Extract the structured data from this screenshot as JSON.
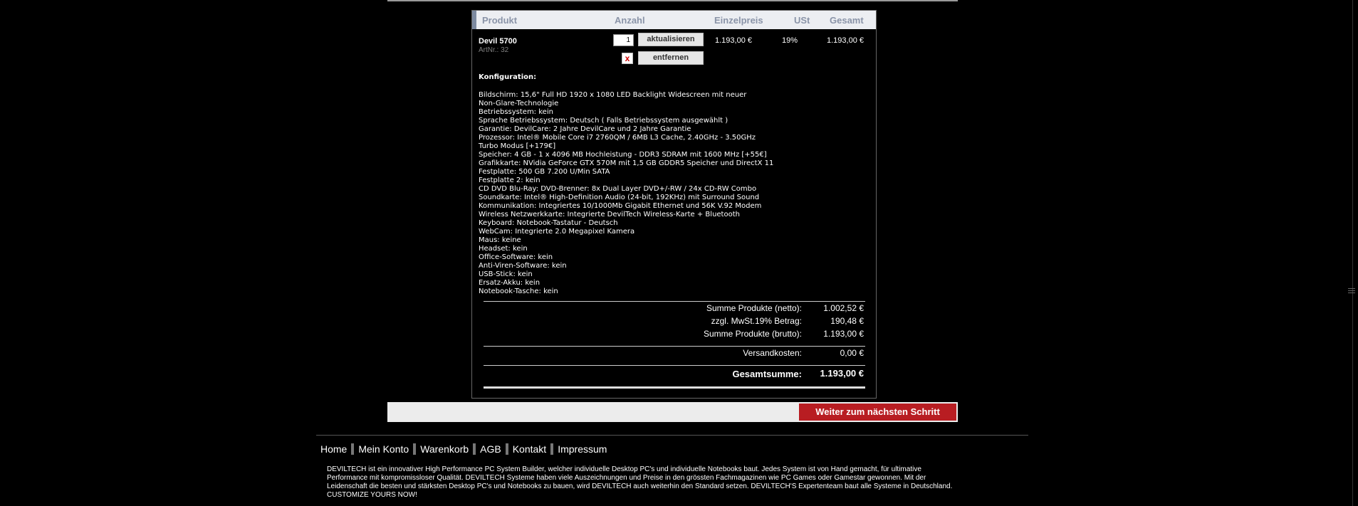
{
  "header": {
    "produkt": "Produkt",
    "anzahl": "Anzahl",
    "einzelpreis": "Einzelpreis",
    "ust": "USt",
    "gesamt": "Gesamt"
  },
  "item": {
    "name": "Devil 5700",
    "artnr": "ArtNr.: 32",
    "quantity": "1",
    "update_label": "aktualisieren",
    "remove_icon": "x",
    "remove_label": "entfernen",
    "unit_price": "1.193,00 €",
    "vat": "19%",
    "total": "1.193,00 €"
  },
  "config": {
    "title": "Konfiguration:",
    "lines": [
      "Bildschirm: 15,6\" Full HD 1920 x 1080 LED Backlight Widescreen mit neuer",
      "Non-Glare-Technologie",
      "Betriebssystem: kein",
      "Sprache Betriebssystem: Deutsch ( Falls Betriebssystem ausgewählt )",
      "Garantie: DevilCare: 2 Jahre DevilCare und 2 Jahre Garantie",
      "Prozessor: Intel® Mobile Core i7 2760QM / 6MB L3 Cache, 2.40GHz - 3.50GHz",
      "Turbo Modus [+179€]",
      "Speicher: 4 GB - 1 x 4096 MB Hochleistung - DDR3 SDRAM mit 1600 MHz [+55€]",
      "Grafikkarte: NVidia GeForce GTX 570M mit 1,5 GB GDDR5 Speicher und DirectX 11",
      "Festplatte: 500 GB 7.200 U/Min SATA",
      "Festplatte 2: kein",
      "CD DVD Blu-Ray: DVD-Brenner: 8x Dual Layer DVD+/-RW / 24x CD-RW Combo",
      "Soundkarte: Intel® High-Definition Audio (24-bit, 192KHz) mit Surround Sound",
      "Kommunikation: Integriertes 10/1000Mb Gigabit Ethernet und 56K V.92 Modem",
      "Wireless Netzwerkkarte: Integrierte DevilTech Wireless-Karte + Bluetooth",
      "Keyboard: Notebook-Tastatur - Deutsch",
      "WebCam: Integrierte 2.0 Megapixel Kamera",
      "Maus: keine",
      "Headset: kein",
      "Office-Software: kein",
      "Anti-Viren-Software: kein",
      "USB-Stick: kein",
      "Ersatz-Akku: kein",
      "Notebook-Tasche: kein"
    ]
  },
  "totals": {
    "netto_label": "Summe Produkte (netto):",
    "netto_value": "1.002,52 €",
    "mwst_label": "zzgl. MwSt.19% Betrag:",
    "mwst_value": "190,48 €",
    "brutto_label": "Summe Produkte (brutto):",
    "brutto_value": "1.193,00 €",
    "versand_label": "Versandkosten:",
    "versand_value": "0,00 €",
    "gesamt_label": "Gesamtsumme:",
    "gesamt_value": "1.193,00 €"
  },
  "next_button": "Weiter zum nächsten Schritt",
  "footer": {
    "nav": [
      "Home",
      "Mein Konto",
      "Warenkorb",
      "AGB",
      "Kontakt",
      "Impressum"
    ],
    "about": "DEVILTECH ist ein innovativer High Performance PC System Builder, welcher individuelle Desktop PC's und individuelle Notebooks baut. Jedes System ist von Hand gemacht, für ultimative Performance mit kompromissloser Qualität. DEVILTECH Systeme haben viele Auszeichnungen und Preise in den grössten Fachmagazinen wie PC Games oder Gamestar gewonnen. Mit der Leidenschaft die besten und stärksten Desktop PC's und Notebooks zu bauen, wird DEVILTECH auch weiterhin den Standard setzen. DEVILTECH'S Expertenteam baut alle Systeme in Deutschland. CUSTOMIZE YOURS NOW!"
  }
}
